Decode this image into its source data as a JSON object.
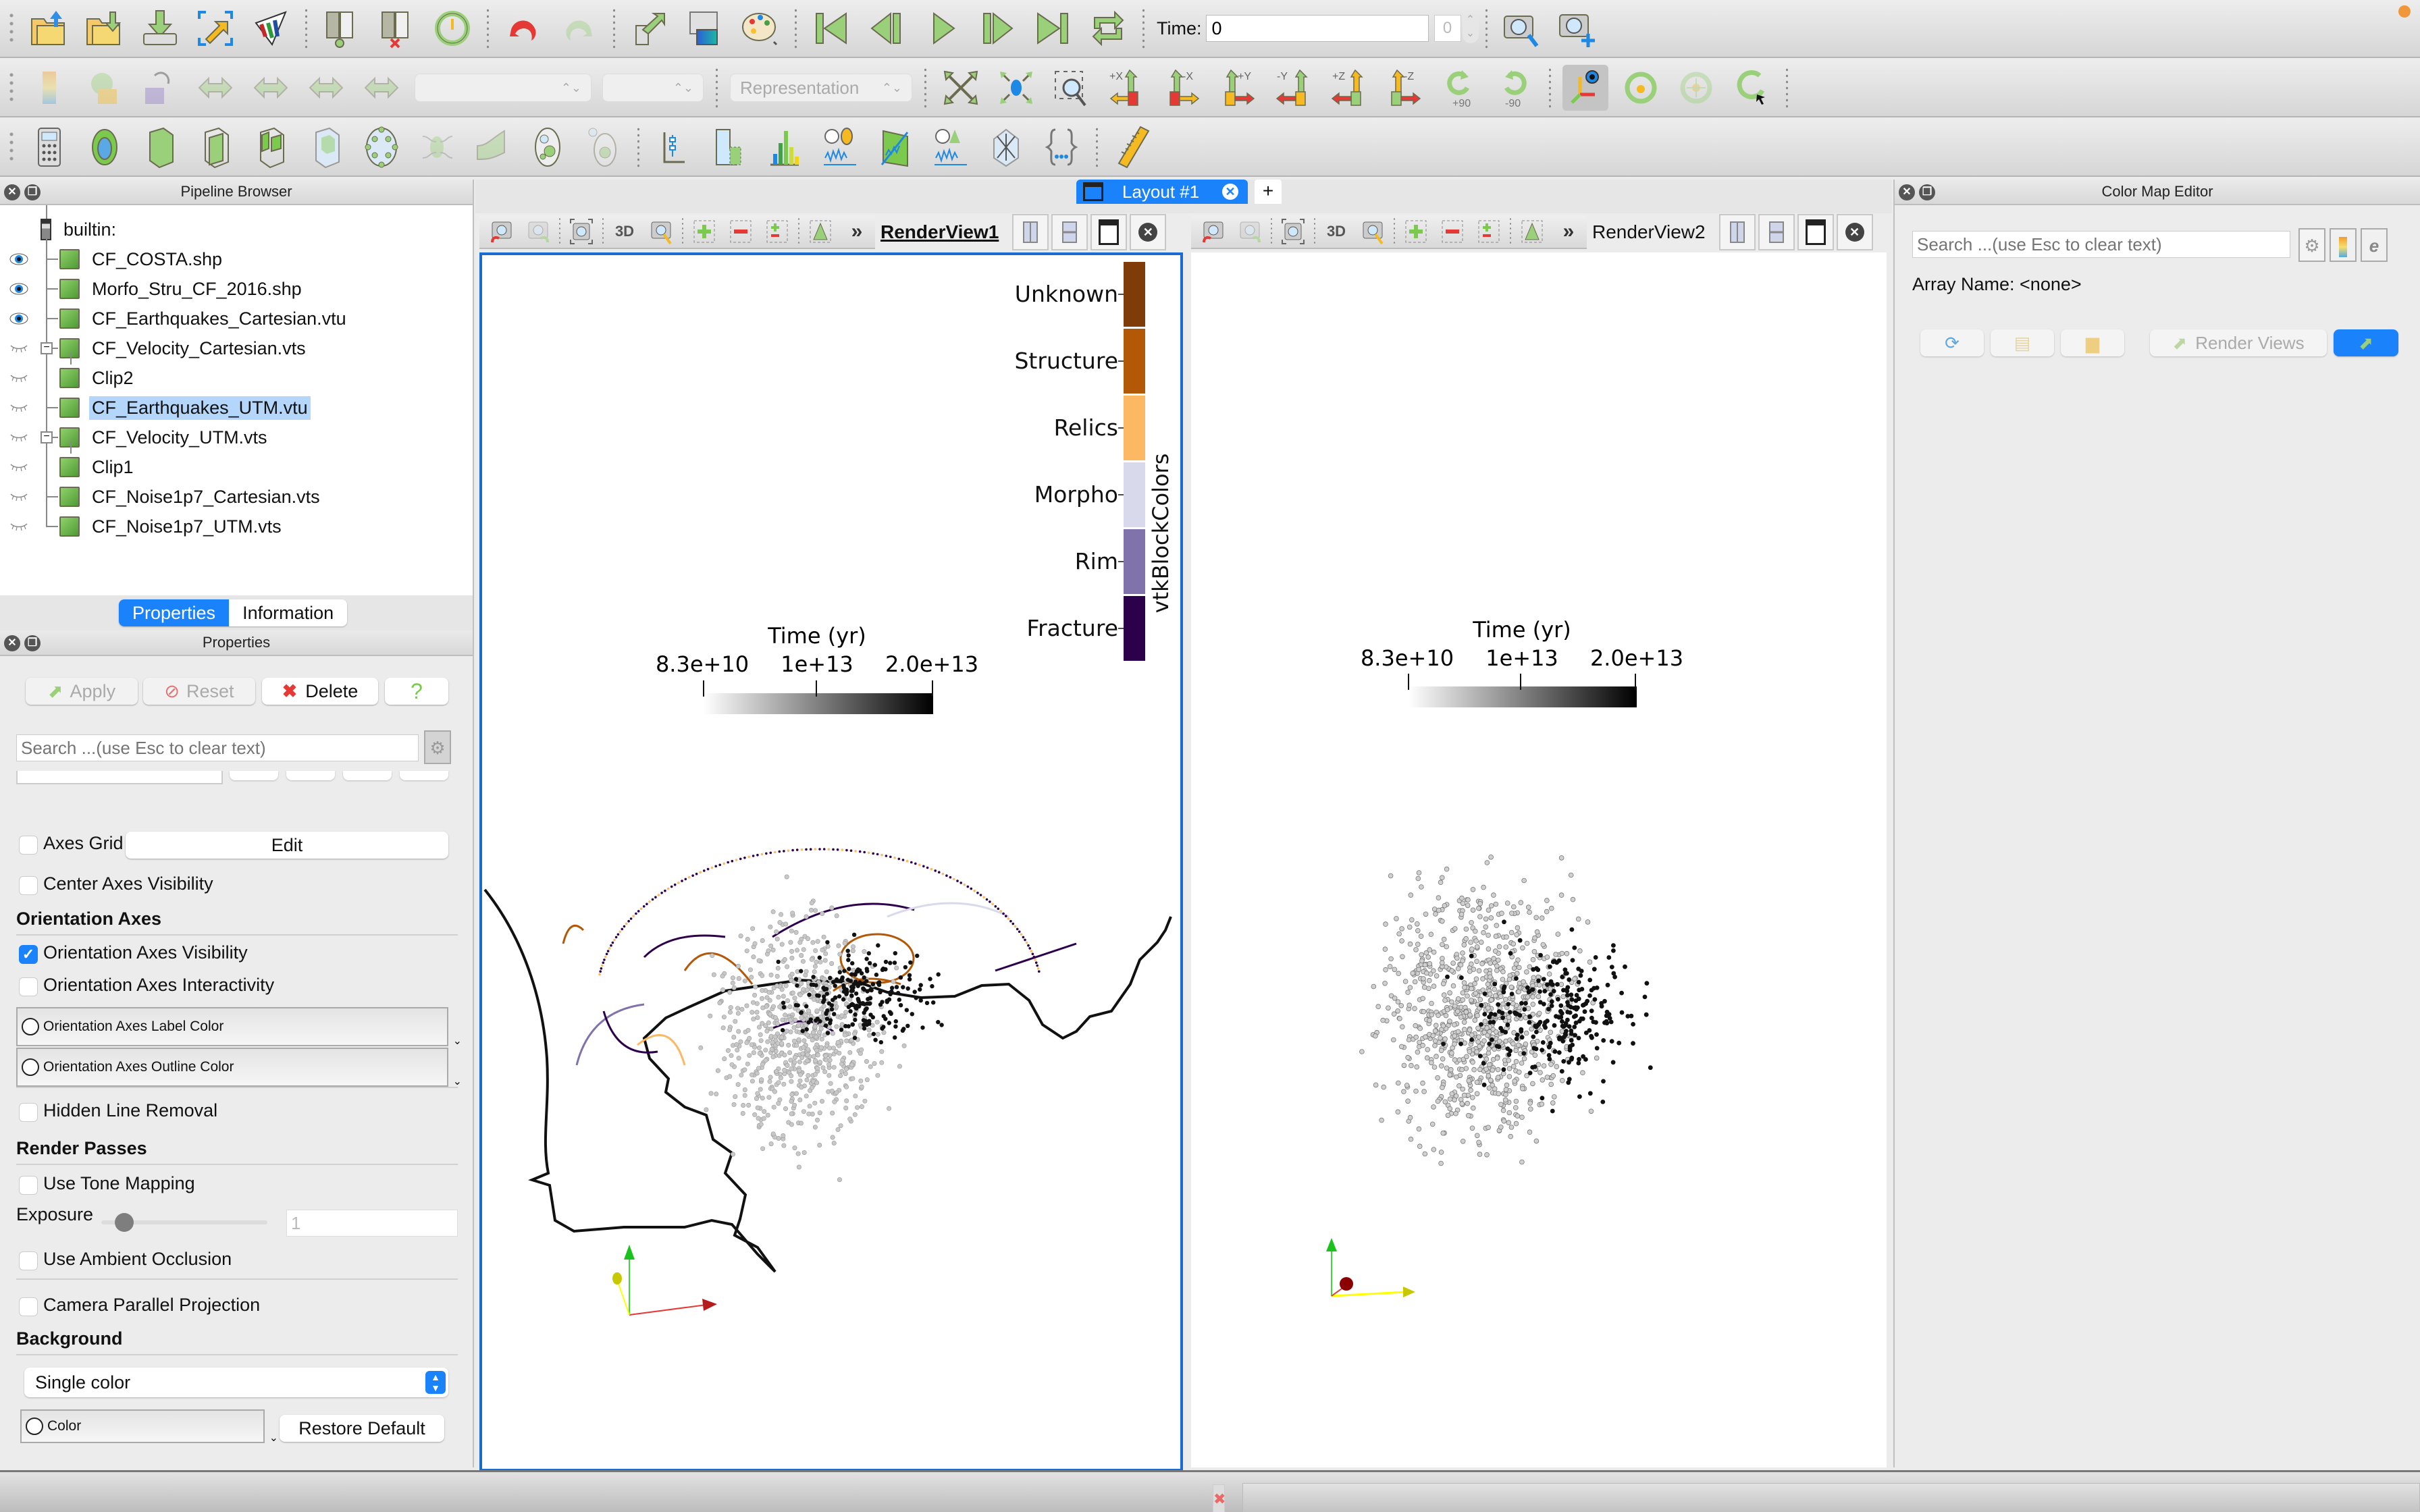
{
  "toolbar_main": {
    "time_label": "Time:",
    "time_value": "0",
    "time_index": "0",
    "buttons": [
      "open-file",
      "save-data",
      "load-state",
      "connect",
      "disconnect",
      "reset-session",
      "undo",
      "redo",
      "apply",
      "edit-color-map",
      "color-palette",
      "first-frame",
      "previous-frame",
      "play",
      "next-frame",
      "last-frame",
      "loop",
      "capture-screenshot",
      "capture-view"
    ]
  },
  "toolbar_view": {
    "representation_placeholder": "Representation",
    "rotate_plus90": "+90",
    "rotate_minus90": "-90",
    "axis_buttons": [
      "+X",
      "-X",
      "+Y",
      "-Y",
      "+Z",
      "-Z"
    ]
  },
  "pipeline": {
    "title": "Pipeline Browser",
    "root": "builtin:",
    "items": [
      {
        "label": "CF_COSTA.shp",
        "visible": true,
        "expander": false,
        "indent": 0
      },
      {
        "label": "Morfo_Stru_CF_2016.shp",
        "visible": true,
        "expander": false,
        "indent": 0
      },
      {
        "label": "CF_Earthquakes_Cartesian.vtu",
        "visible": true,
        "expander": false,
        "indent": 0
      },
      {
        "label": "CF_Velocity_Cartesian.vts",
        "visible": false,
        "expander": true,
        "indent": 0
      },
      {
        "label": "Clip2",
        "visible": false,
        "expander": false,
        "indent": 1
      },
      {
        "label": "CF_Earthquakes_UTM.vtu",
        "visible": false,
        "expander": false,
        "indent": 0,
        "selected": true
      },
      {
        "label": "CF_Velocity_UTM.vts",
        "visible": false,
        "expander": true,
        "indent": 0
      },
      {
        "label": "Clip1",
        "visible": false,
        "expander": false,
        "indent": 1
      },
      {
        "label": "CF_Noise1p7_Cartesian.vts",
        "visible": false,
        "expander": false,
        "indent": 0
      },
      {
        "label": "CF_Noise1p7_UTM.vts",
        "visible": false,
        "expander": false,
        "indent": 0
      }
    ]
  },
  "tabs": {
    "properties": "Properties",
    "information": "Information",
    "active": "Properties"
  },
  "properties": {
    "title": "Properties",
    "apply": "Apply",
    "reset": "Reset",
    "delete": "Delete",
    "help": "?",
    "search_placeholder": "Search ...(use Esc to clear text)",
    "axes_grid": {
      "label": "Axes Grid",
      "checked": false,
      "edit": "Edit"
    },
    "center_axes_visibility": {
      "label": "Center Axes Visibility",
      "checked": false
    },
    "orientation_axes_section": "Orientation Axes",
    "orientation_axes_visibility": {
      "label": "Orientation Axes Visibility",
      "checked": true
    },
    "orientation_axes_interactivity": {
      "label": "Orientation Axes Interactivity",
      "checked": false
    },
    "orientation_axes_label_color": "Orientation Axes Label Color",
    "orientation_axes_outline_color": "Orientation Axes Outline Color",
    "hidden_line_removal": {
      "label": "Hidden Line Removal",
      "checked": false
    },
    "render_passes_section": "Render Passes",
    "use_tone_mapping": {
      "label": "Use Tone Mapping",
      "checked": false
    },
    "exposure": {
      "label": "Exposure",
      "value": "1",
      "slider_fraction": 0.0
    },
    "use_ambient_occlusion": {
      "label": "Use Ambient Occlusion",
      "checked": false
    },
    "camera_parallel_projection": {
      "label": "Camera Parallel Projection",
      "checked": false
    },
    "background_section": "Background",
    "background_mode": "Single color",
    "color_button": "Color",
    "restore_default": "Restore Default"
  },
  "layout": {
    "tab_label": "Layout #1",
    "add_tab": "+",
    "views": [
      {
        "title": "RenderView1",
        "active": true,
        "three_d": "3D"
      },
      {
        "title": "RenderView2",
        "active": false,
        "three_d": "3D"
      }
    ]
  },
  "legend_block": {
    "title": "vtkBlockColors",
    "entries": [
      {
        "label": "Unknown",
        "color": "#7f3b08"
      },
      {
        "label": "Structure",
        "color": "#b35806"
      },
      {
        "label": "Relics",
        "color": "#fdb863"
      },
      {
        "label": "Morpho",
        "color": "#d8daeb"
      },
      {
        "label": "Rim",
        "color": "#8073ac"
      },
      {
        "label": "Fracture",
        "color": "#2d004b"
      }
    ]
  },
  "legend_time": {
    "title": "Time  (yr)",
    "min_label": "8.3e+10",
    "mid_label": "1e+13",
    "max_label": "2.0e+13",
    "color_start": "#ffffff",
    "color_end": "#000000"
  },
  "color_map_editor": {
    "title": "Color Map Editor",
    "search_placeholder": "Search ...(use Esc to clear text)",
    "array_name": "Array Name: <none>",
    "render_views": "Render Views"
  },
  "colors": {
    "accent": "#1a82fb",
    "active_view_border": "#1b6bd4",
    "selection": "#b4d6fa",
    "notification": "#f0973a"
  }
}
